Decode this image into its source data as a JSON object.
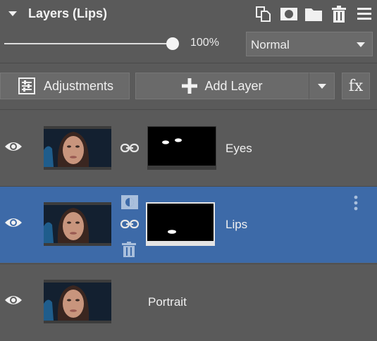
{
  "panel": {
    "title": "Layers (Lips)",
    "header_icons": [
      "duplicate-layer-icon",
      "mask-icon",
      "folder-icon",
      "delete-icon",
      "menu-icon"
    ]
  },
  "opacity": {
    "value_label": "100%",
    "fraction": 1.0
  },
  "blend_mode": {
    "selected": "Normal"
  },
  "toolbar": {
    "adjustments_label": "Adjustments",
    "add_layer_label": "Add Layer",
    "fx_label": "fx"
  },
  "layers": [
    {
      "name": "Eyes",
      "selected": false,
      "has_mask": true
    },
    {
      "name": "Lips",
      "selected": true,
      "has_mask": true
    },
    {
      "name": "Portrait",
      "selected": false,
      "has_mask": false
    }
  ],
  "colors": {
    "panel_bg": "#5a5a5a",
    "selected_row": "#3d6aa8",
    "button_bg": "#6a6a6a"
  }
}
